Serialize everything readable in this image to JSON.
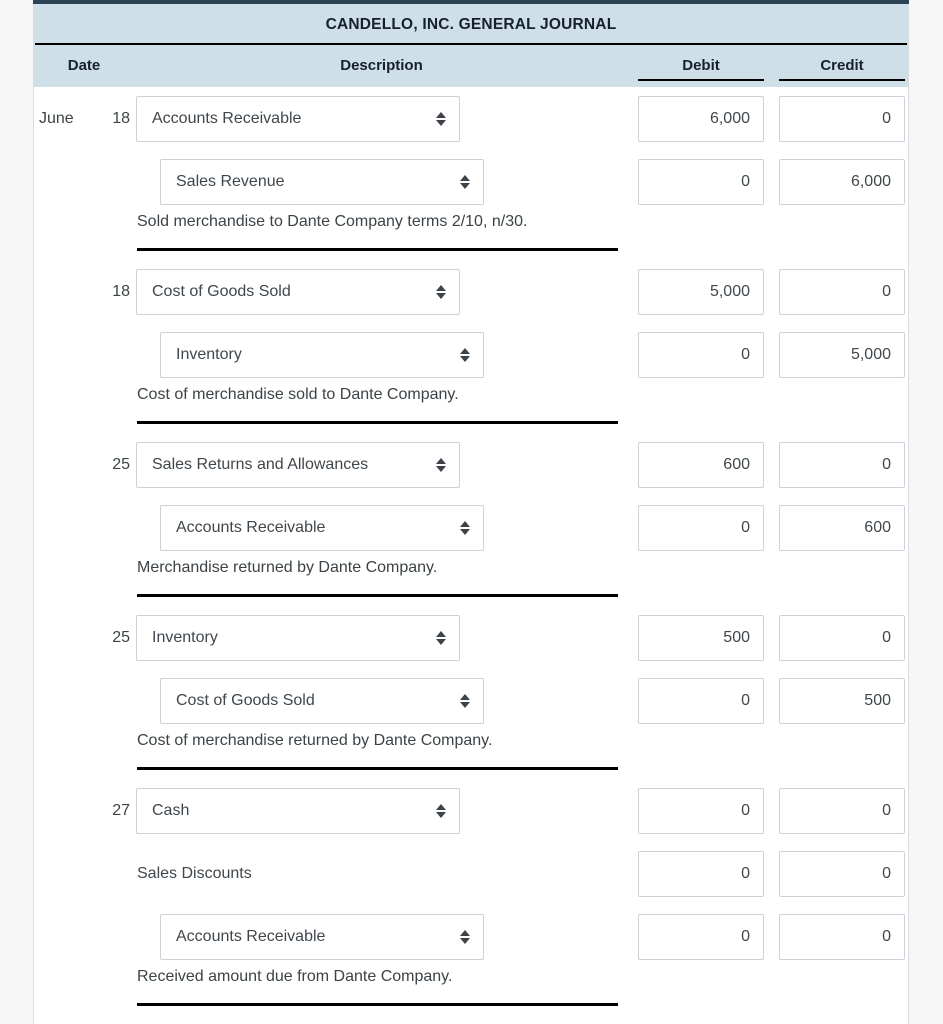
{
  "header": {
    "title": "CANDELLO, INC. GENERAL JOURNAL",
    "col_date": "Date",
    "col_description": "Description",
    "col_debit": "Debit",
    "col_credit": "Credit"
  },
  "colors": {
    "header_bg": "#cfdfe8",
    "top_strip": "#2c4356",
    "page_bg": "#f7f7f7",
    "field_border": "#ccd2d8",
    "text": "#40474c",
    "rule": "#000000"
  },
  "entries": [
    {
      "month": "June",
      "day": "18",
      "lines": [
        {
          "account": "Accounts Receivable",
          "control": "select",
          "indent": 1,
          "debit": "6,000",
          "credit": "0"
        },
        {
          "account": "Sales Revenue",
          "control": "select",
          "indent": 2,
          "debit": "0",
          "credit": "6,000"
        }
      ],
      "narration": "Sold merchandise to Dante Company terms 2/10, n/30."
    },
    {
      "month": "",
      "day": "18",
      "lines": [
        {
          "account": "Cost of Goods Sold",
          "control": "select",
          "indent": 1,
          "debit": "5,000",
          "credit": "0"
        },
        {
          "account": "Inventory",
          "control": "select",
          "indent": 2,
          "debit": "0",
          "credit": "5,000"
        }
      ],
      "narration": "Cost of merchandise sold to Dante Company."
    },
    {
      "month": "",
      "day": "25",
      "lines": [
        {
          "account": "Sales Returns and Allowances",
          "control": "select",
          "indent": 1,
          "debit": "600",
          "credit": "0"
        },
        {
          "account": "Accounts Receivable",
          "control": "select",
          "indent": 2,
          "debit": "0",
          "credit": "600"
        }
      ],
      "narration": "Merchandise returned by Dante Company."
    },
    {
      "month": "",
      "day": "25",
      "lines": [
        {
          "account": "Inventory",
          "control": "select",
          "indent": 1,
          "debit": "500",
          "credit": "0"
        },
        {
          "account": "Cost of Goods Sold",
          "control": "select",
          "indent": 2,
          "debit": "0",
          "credit": "500"
        }
      ],
      "narration": "Cost of merchandise returned by Dante Company."
    },
    {
      "month": "",
      "day": "27",
      "lines": [
        {
          "account": "Cash",
          "control": "select",
          "indent": 1,
          "debit": "0",
          "credit": "0"
        },
        {
          "account": "Sales Discounts",
          "control": "text",
          "indent": 1,
          "debit": "0",
          "credit": "0"
        },
        {
          "account": "Accounts Receivable",
          "control": "select",
          "indent": 2,
          "debit": "0",
          "credit": "0"
        }
      ],
      "narration": "Received amount due from Dante Company."
    }
  ]
}
